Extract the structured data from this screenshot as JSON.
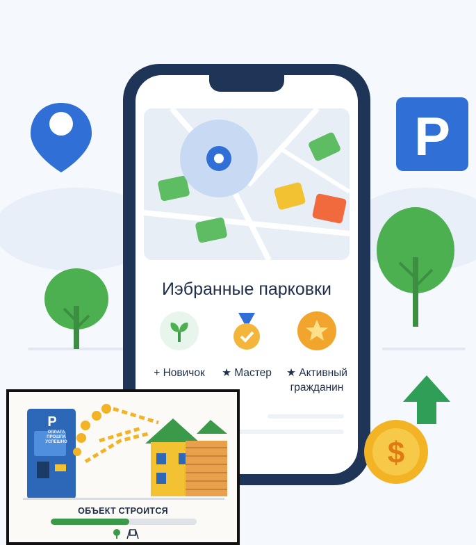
{
  "screen": {
    "title": "Иэбранные парковки",
    "badges": [
      {
        "prefix": "+",
        "label": "Новичок",
        "icon": "sprout-icon",
        "color": "#e9f6ee"
      },
      {
        "prefix": "★",
        "label": "Мастер",
        "icon": "medal-icon",
        "color": "#f4b63a"
      },
      {
        "prefix": "★",
        "label": "Активный гражданин",
        "icon": "star-icon",
        "color": "#f2a52c"
      }
    ]
  },
  "parking_sign": {
    "letter": "P"
  },
  "coin": {
    "symbol": "$"
  },
  "inset": {
    "kiosk_letter": "P",
    "kiosk_screen_text": "ОПЛАТА ПРОШЛА УСПЕШНО",
    "status": "ОБЪЕКТ СТРОИТСЯ",
    "progress": 0.54,
    "icons": [
      "tree-icon",
      "swing-icon"
    ]
  },
  "colors": {
    "navy": "#1e3557",
    "blue": "#2f6fd6",
    "green": "#4caf50",
    "yellow": "#f2c233",
    "orange": "#f06a3e"
  }
}
